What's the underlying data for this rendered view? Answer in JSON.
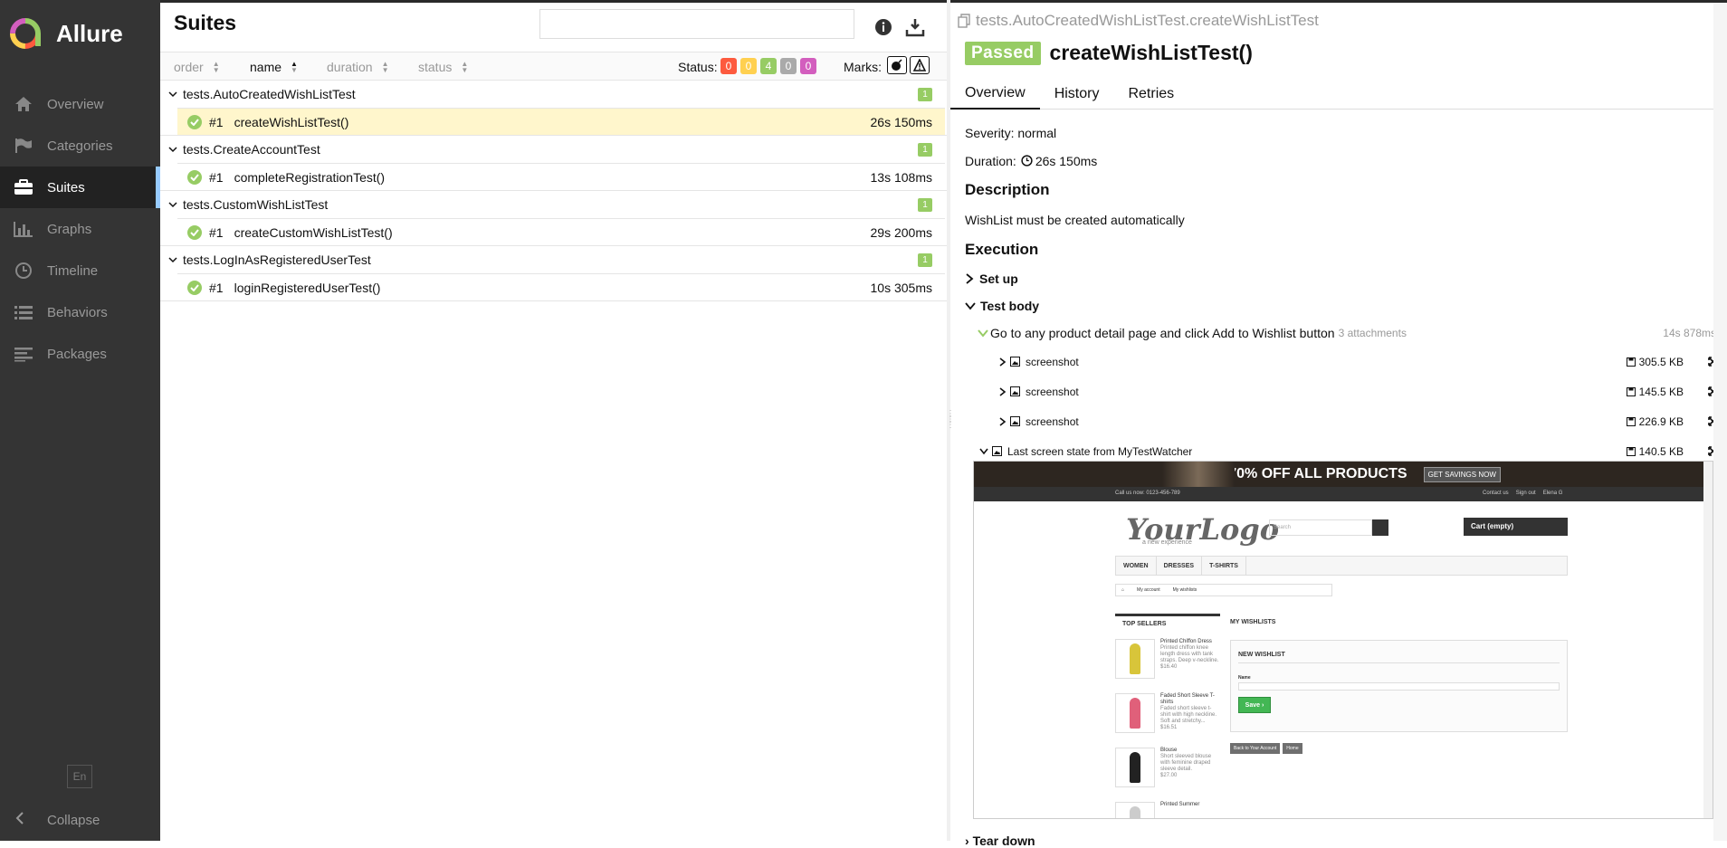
{
  "sidebar": {
    "brand": "Allure",
    "items": [
      {
        "label": "Overview",
        "icon": "home-icon"
      },
      {
        "label": "Categories",
        "icon": "flag-icon"
      },
      {
        "label": "Suites",
        "icon": "briefcase-icon"
      },
      {
        "label": "Graphs",
        "icon": "bar-chart-icon"
      },
      {
        "label": "Timeline",
        "icon": "clock-icon"
      },
      {
        "label": "Behaviors",
        "icon": "list-icon"
      },
      {
        "label": "Packages",
        "icon": "align-left-icon"
      }
    ],
    "active": "Suites",
    "language": "En",
    "collapse_label": "Collapse"
  },
  "suites": {
    "title": "Suites",
    "search_placeholder": "",
    "sort": {
      "order": "order",
      "name": "name",
      "duration": "duration",
      "status": "status",
      "active": "name"
    },
    "status_label": "Status:",
    "status_counts": [
      {
        "value": "0",
        "color": "#fd5a3e"
      },
      {
        "value": "0",
        "color": "#ffd050"
      },
      {
        "value": "4",
        "color": "#97cc64"
      },
      {
        "value": "0",
        "color": "#aaaaaa"
      },
      {
        "value": "0",
        "color": "#d35ebe"
      }
    ],
    "marks_label": "Marks:",
    "groups": [
      {
        "name": "tests.AutoCreatedWishListTest",
        "count": "1",
        "tests": [
          {
            "num": "#1",
            "name": "createWishListTest()",
            "duration": "26s 150ms",
            "selected": true
          }
        ]
      },
      {
        "name": "tests.CreateAccountTest",
        "count": "1",
        "tests": [
          {
            "num": "#1",
            "name": "completeRegistrationTest()",
            "duration": "13s 108ms",
            "selected": false
          }
        ]
      },
      {
        "name": "tests.CustomWishListTest",
        "count": "1",
        "tests": [
          {
            "num": "#1",
            "name": "createCustomWishListTest()",
            "duration": "29s 200ms",
            "selected": false
          }
        ]
      },
      {
        "name": "tests.LogInAsRegisteredUserTest",
        "count": "1",
        "tests": [
          {
            "num": "#1",
            "name": "loginRegisteredUserTest()",
            "duration": "10s 305ms",
            "selected": false
          }
        ]
      }
    ]
  },
  "details": {
    "path": "tests.AutoCreatedWishListTest.createWishListTest",
    "status": "Passed",
    "title": "createWishListTest()",
    "tabs": [
      "Overview",
      "History",
      "Retries"
    ],
    "active_tab": "Overview",
    "severity": "Severity: normal",
    "duration_label": "Duration:",
    "duration": "26s 150ms",
    "description_heading": "Description",
    "description": "WishList must be created automatically",
    "execution_heading": "Execution",
    "setup": "Set up",
    "test_body": "Test body",
    "step": {
      "name": "Go to any product detail page and click Add to Wishlist button",
      "attachments": "3 attachments",
      "time": "14s 878ms"
    },
    "attachments": [
      {
        "name": "screenshot",
        "size": "305.5 KB"
      },
      {
        "name": "screenshot",
        "size": "145.5 KB"
      },
      {
        "name": "screenshot",
        "size": "226.9 KB"
      }
    ],
    "last_screen": {
      "name": "Last screen state from MyTestWatcher",
      "size": "140.5 KB"
    },
    "teardown": "Tear down"
  },
  "preview": {
    "banner": "SALE 70% OFF ALL PRODUCTS",
    "banner_cta": "GET SAVINGS NOW",
    "call_us": "Call us now: 0123-456-789",
    "top_links": [
      "Contact us",
      "Sign out",
      "Elena G"
    ],
    "logo": "YourLogo",
    "tagline": "a new experience",
    "search_placeholder": "Search",
    "cart": "Cart (empty)",
    "menu": [
      "WOMEN",
      "DRESSES",
      "T-SHIRTS"
    ],
    "crumbs": [
      "My account",
      "My wishlists"
    ],
    "top_sellers": "TOP SELLERS",
    "products": [
      {
        "name": "Printed Chiffon Dress",
        "desc": "Printed chiffon knee length dress with tank straps. Deep v-neckline.",
        "price": "$16.40",
        "color": "#d8c53a"
      },
      {
        "name": "Faded Short Sleeve T-shirts",
        "desc": "Faded short sleeve t-shirt with high neckline. Soft and stretchy...",
        "price": "$16.51",
        "color": "#e0607a"
      },
      {
        "name": "Blouse",
        "desc": "Short sleeved blouse with feminine draped sleeve detail.",
        "price": "$27.00",
        "color": "#222222"
      },
      {
        "name": "Printed Summer",
        "desc": "",
        "price": "",
        "color": "#cccccc"
      }
    ],
    "my_wishlists": "MY WISHLISTS",
    "new_wishlist": "NEW WISHLIST",
    "name_label": "Name",
    "save": "Save",
    "back_account": "Back to Your Account",
    "home": "Home"
  }
}
